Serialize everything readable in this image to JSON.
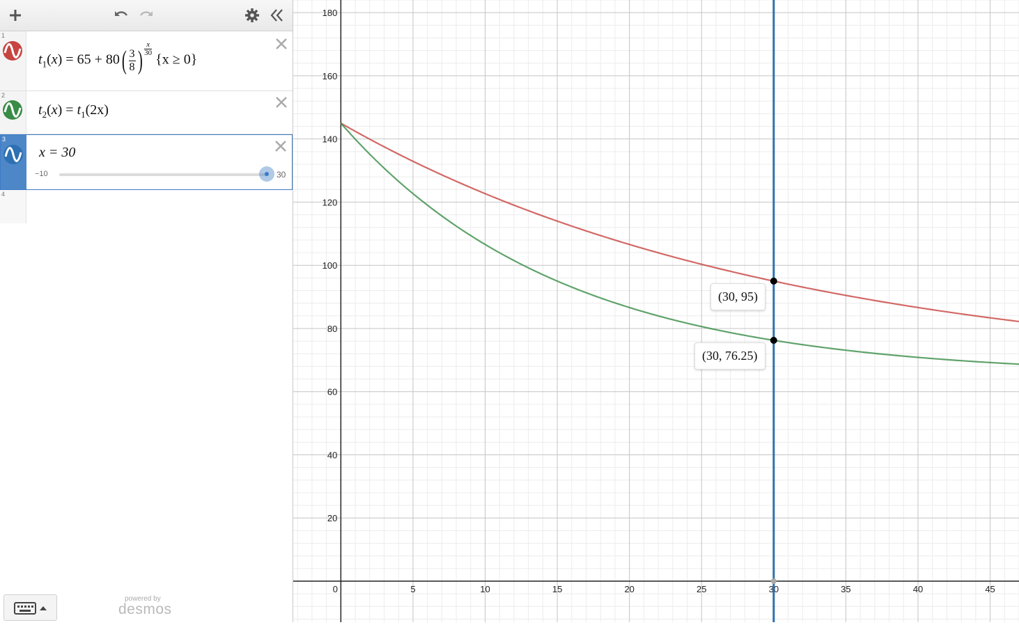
{
  "toolbar": {
    "add_icon": "plus-icon",
    "undo_icon": "undo-icon",
    "redo_icon": "redo-icon",
    "settings_icon": "gear-icon",
    "collapse_icon": "double-chevron-left-icon"
  },
  "expressions": [
    {
      "index": "1",
      "color": "#c74440",
      "fn": "t",
      "sub": "1",
      "arg": "x",
      "eq": "= 65 + 80",
      "frac_num": "3",
      "frac_den": "8",
      "exp_num": "x",
      "exp_den": "30",
      "restriction": "{x ≥ 0}"
    },
    {
      "index": "2",
      "color": "#388c46",
      "fn": "t",
      "sub": "2",
      "arg": "x",
      "eq": "=",
      "rhs_fn": "t",
      "rhs_sub": "1",
      "rhs_arg": "(2x)"
    },
    {
      "index": "3",
      "color": "#2d70b3",
      "latex": "x = 30",
      "slider": {
        "min": "−10",
        "max": "30",
        "value": 30
      }
    },
    {
      "index": "4"
    }
  ],
  "keyboard": {
    "icon": "keyboard-icon",
    "toggle_icon": "caret-up-icon"
  },
  "branding": {
    "powered_by": "powered by",
    "logo": "desmos"
  },
  "graph": {
    "x_ticks": [
      "0",
      "5",
      "10",
      "15",
      "20",
      "25",
      "30",
      "35",
      "40",
      "45"
    ],
    "y_ticks": [
      "20",
      "40",
      "60",
      "80",
      "100",
      "120",
      "140",
      "160",
      "180"
    ],
    "points": [
      {
        "label": "(30, 95)"
      },
      {
        "label": "(30, 76.25)"
      }
    ]
  },
  "chart_data": {
    "type": "line",
    "xlim": [
      -3.3,
      47
    ],
    "ylim": [
      -13,
      184
    ],
    "grid": true,
    "series": [
      {
        "color": "#c74440",
        "formula": "65 + 80*(3/8)^(x/30), x >= 0",
        "x": [
          0,
          5,
          10,
          15,
          20,
          25,
          30,
          35,
          40,
          45,
          47
        ],
        "y": [
          145,
          133.2,
          122.7,
          114.0,
          106.6,
          100.3,
          95.0,
          90.6,
          86.8,
          83.6,
          82.5
        ]
      },
      {
        "color": "#388c46",
        "formula": "65 + 80*(3/8)^(2x/30), x >= 0",
        "x": [
          0,
          5,
          10,
          15,
          20,
          25,
          30,
          35,
          40,
          45,
          47
        ],
        "y": [
          145,
          122.7,
          106.6,
          95.0,
          86.8,
          80.8,
          76.25,
          73.3,
          71.2,
          69.5,
          69.0
        ]
      },
      {
        "color": "#2d70b3",
        "type": "vertical-line",
        "x": 30
      }
    ],
    "points": [
      {
        "x": 30,
        "y": 95
      },
      {
        "x": 30,
        "y": 76.25
      }
    ]
  }
}
